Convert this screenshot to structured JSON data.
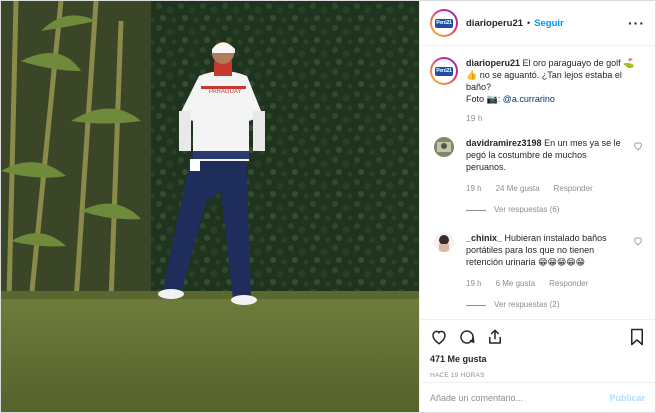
{
  "post": {
    "username": "diarioperu21",
    "avatar_logo": "Perú21",
    "follow_label": "Seguir",
    "more_icon": "more-options-icon",
    "jersey_text": "PARAGUAY"
  },
  "caption": {
    "username": "diarioperu21",
    "text_1": "El oro paraguayo de golf",
    "emojis_1": "⛳👍",
    "text_2": "no se aguantó. ¿Tan lejos estaba el baño?",
    "text_3": "Foto",
    "emoji_3": "📷",
    "text_4": ":",
    "mention": "@a.currarino",
    "time": "19 h"
  },
  "comments": [
    {
      "username": "davidramirez3198",
      "text": "En un mes ya se le pegó la costumbre de muchos peruanos.",
      "time": "19 h",
      "likes": "24 Me gusta",
      "reply": "Responder",
      "view_replies": "Ver respuestas (6)"
    },
    {
      "username": "_chinix_",
      "text": "Hubieran instalado baños portátiles para los que no tienen retención urinaria",
      "emojis": "😁😁😁😁😁",
      "time": "19 h",
      "likes": "6 Me gusta",
      "reply": "Responder",
      "view_replies": "Ver respuestas (2)"
    }
  ],
  "actions": {
    "icons": [
      "heart-icon",
      "comment-icon",
      "share-icon",
      "bookmark-icon"
    ],
    "likes": "471 Me gusta",
    "timestamp": "HACE 19 HORAS"
  },
  "add_comment": {
    "placeholder": "Añade un comentario...",
    "publish_label": "Publicar"
  },
  "colors": {
    "link_blue": "#0095f6",
    "publish_disabled": "#b3dbff",
    "muted": "#8e8e8e",
    "text": "#262626"
  }
}
